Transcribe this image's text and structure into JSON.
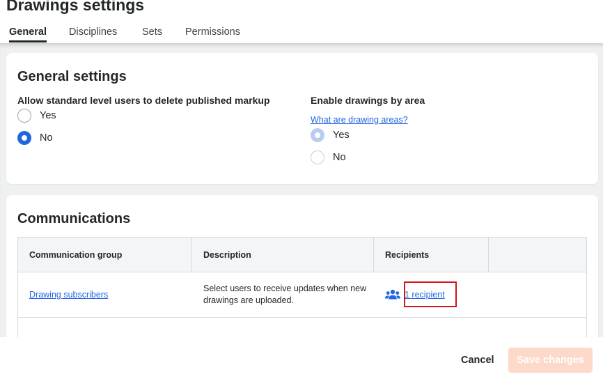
{
  "page": {
    "title": "Drawings settings",
    "tabs": [
      "General",
      "Disciplines",
      "Sets",
      "Permissions"
    ],
    "active_tab": "General"
  },
  "general": {
    "title": "General settings",
    "delete_markup": {
      "label": "Allow standard level users to delete published markup",
      "options": [
        "Yes",
        "No"
      ],
      "selected": "No"
    },
    "drawings_by_area": {
      "label": "Enable drawings by area",
      "help_link": "What are drawing areas?",
      "options": [
        "Yes",
        "No"
      ],
      "selected": "Yes",
      "disabled": true
    }
  },
  "communications": {
    "title": "Communications",
    "columns": [
      "Communication group",
      "Description",
      "Recipients",
      ""
    ],
    "rows": [
      {
        "group": "Drawing subscribers",
        "description": "Select users to receive updates when new drawings are uploaded.",
        "recipients": "1 recipient",
        "icon": "group-icon"
      }
    ]
  },
  "footer": {
    "cancel_label": "Cancel",
    "save_label": "Save changes"
  },
  "colors": {
    "accent": "#2066df",
    "save_disabled": "#fdd9c9",
    "highlight": "#d3141a"
  }
}
